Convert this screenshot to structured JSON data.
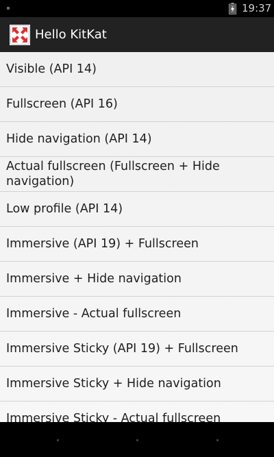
{
  "status_bar": {
    "time": "19:37",
    "battery_icon": "battery-charging-icon"
  },
  "action_bar": {
    "app_icon": "fullscreen-arrows-icon",
    "title": "Hello KitKat"
  },
  "colors": {
    "action_bar_bg": "#222222",
    "list_bg": "#f2f2f2",
    "divider": "#d2d2d2",
    "app_icon_bg": "#d93030"
  },
  "list": {
    "items": [
      {
        "label": "Visible (API 14)"
      },
      {
        "label": "Fullscreen (API 16)"
      },
      {
        "label": "Hide navigation (API 14)"
      },
      {
        "label": "Actual fullscreen (Fullscreen + Hide navigation)"
      },
      {
        "label": "Low profile (API 14)"
      },
      {
        "label": "Immersive (API 19) + Fullscreen"
      },
      {
        "label": "Immersive + Hide navigation"
      },
      {
        "label": "Immersive - Actual fullscreen"
      },
      {
        "label": "Immersive Sticky (API 19) + Fullscreen"
      },
      {
        "label": "Immersive Sticky + Hide navigation"
      },
      {
        "label": "Immersive Sticky - Actual fullscreen"
      }
    ]
  },
  "nav_bar": {
    "icons": [
      "nav-back-dot-icon",
      "nav-home-dot-icon",
      "nav-recents-dot-icon"
    ]
  }
}
